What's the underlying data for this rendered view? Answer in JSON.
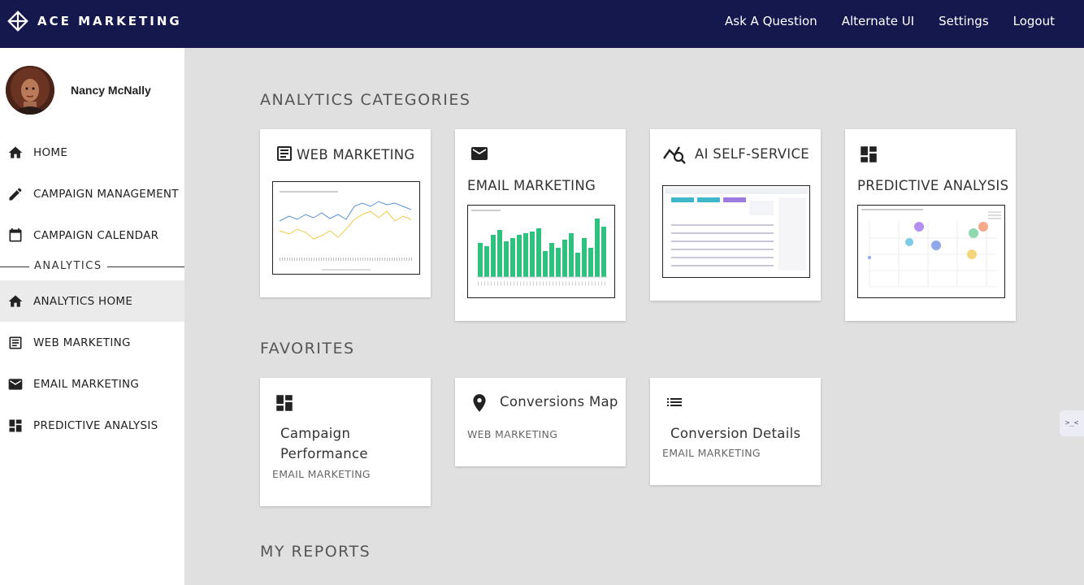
{
  "header": {
    "brand": "ACE MARKETING",
    "nav": [
      "Ask A Question",
      "Alternate UI",
      "Settings",
      "Logout"
    ]
  },
  "sidebar": {
    "user_name": "Nancy McNally",
    "section_label": "ANALYTICS",
    "items": [
      {
        "label": "HOME",
        "icon": "home-icon"
      },
      {
        "label": "CAMPAIGN MANAGEMENT",
        "icon": "pencil-icon"
      },
      {
        "label": "CAMPAIGN CALENDAR",
        "icon": "calendar-icon"
      },
      {
        "label": "ANALYTICS HOME",
        "icon": "home-icon",
        "active": true
      },
      {
        "label": "WEB MARKETING",
        "icon": "web-page-icon"
      },
      {
        "label": "EMAIL MARKETING",
        "icon": "mail-icon"
      },
      {
        "label": "PREDICTIVE ANALYSIS",
        "icon": "dashboard-icon"
      }
    ]
  },
  "main": {
    "categories_title": "ANALYTICS CATEGORIES",
    "categories": [
      {
        "label": "WEB MARKETING",
        "icon": "web-page-icon"
      },
      {
        "label": "EMAIL MARKETING",
        "icon": "mail-icon"
      },
      {
        "label": "AI SELF-SERVICE",
        "icon": "ai-search-icon"
      },
      {
        "label": "PREDICTIVE ANALYSIS",
        "icon": "dashboard-icon"
      }
    ],
    "favorites_title": "FAVORITES",
    "favorites": [
      {
        "title_lines": [
          "Campaign",
          "Performance"
        ],
        "category": "EMAIL MARKETING",
        "icon": "dashboard-icon"
      },
      {
        "title_lines": [
          "Conversions Map"
        ],
        "category": "WEB MARKETING",
        "icon": "map-pin-icon"
      },
      {
        "title_lines": [
          "Conversion Details"
        ],
        "category": "EMAIL MARKETING",
        "icon": "list-icon"
      }
    ],
    "reports_title": "MY REPORTS"
  },
  "colors": {
    "header_bg": "#15184d",
    "accent_green": "#2ec27e",
    "page_bg": "#e0e0e0"
  }
}
